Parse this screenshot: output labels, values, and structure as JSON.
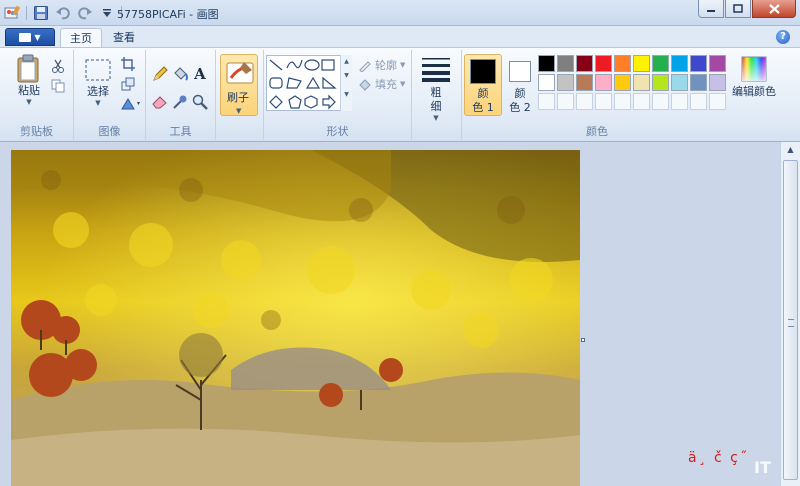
{
  "titlebar": {
    "title": "57758PICAFi - 画图",
    "qat_icons": [
      "paint-app-icon",
      "save-icon",
      "undo-icon",
      "redo-icon",
      "customize-qat-icon"
    ]
  },
  "tabs": [
    {
      "label": "主页",
      "active": true
    },
    {
      "label": "查看",
      "active": false
    }
  ],
  "ribbon": {
    "clipboard": {
      "paste_label": "粘贴",
      "group_label": "剪贴板"
    },
    "image": {
      "select_label": "选择",
      "group_label": "图像"
    },
    "tools": {
      "group_label": "工具"
    },
    "brush": {
      "label": "刷子"
    },
    "shapes": {
      "outline_label": "轮廓",
      "fill_label": "填充",
      "group_label": "形状"
    },
    "size": {
      "label_line1": "粗",
      "label_line2": "细"
    },
    "colors": {
      "color1_line1": "颜",
      "color1_line2": "色 1",
      "color2_line1": "颜",
      "color2_line2": "色 2",
      "edit_label": "编辑颜色",
      "group_label": "颜色",
      "color1_value": "#000000",
      "color2_value": "#ffffff",
      "palette_row1": [
        "#000000",
        "#7f7f7f",
        "#880015",
        "#ed1c24",
        "#ff7f27",
        "#fff200",
        "#22b14c",
        "#00a2e8",
        "#3f48cc",
        "#a349a4"
      ],
      "palette_row2": [
        "#ffffff",
        "#c3c3c3",
        "#b97a57",
        "#ffaec9",
        "#ffc90e",
        "#efe4b0",
        "#b5e61d",
        "#99d9ea",
        "#7092be",
        "#c8bfe7"
      ]
    }
  },
  "overlay_text": "ä¸ č ç˝",
  "watermark": "IT"
}
